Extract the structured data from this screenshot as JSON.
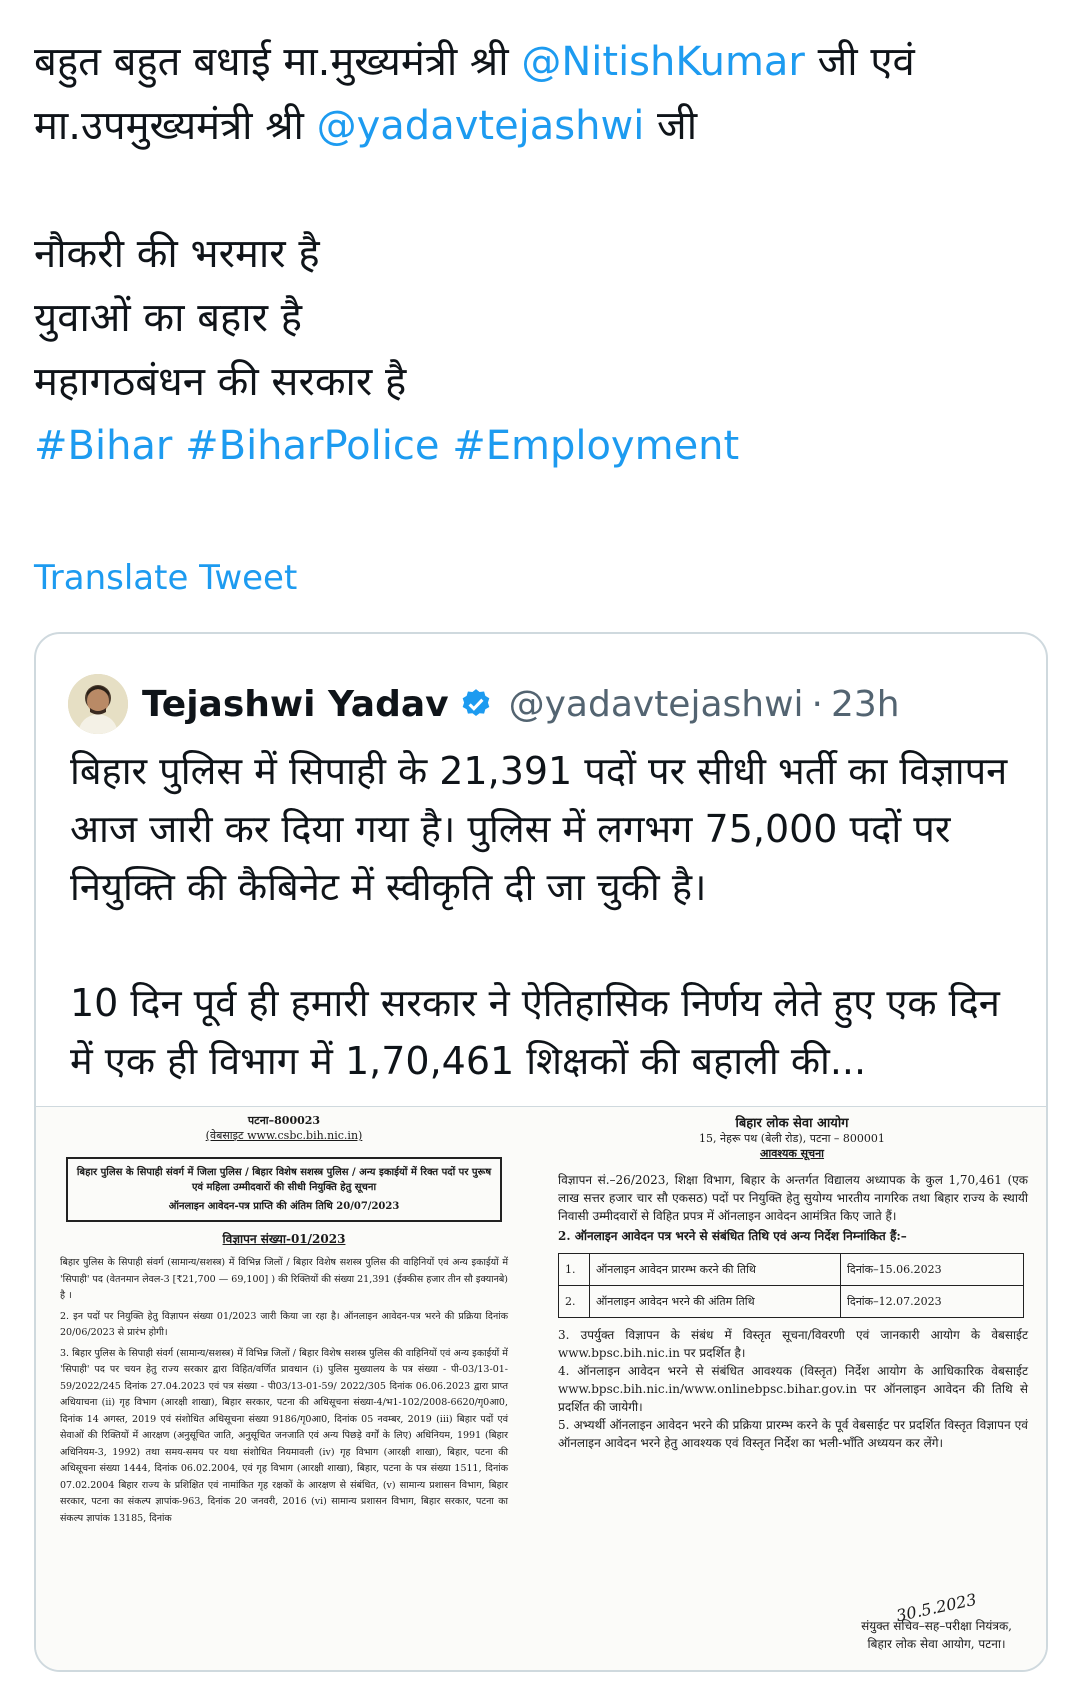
{
  "tweet": {
    "line1_text": "बहुत बहुत बधाई मा.मुख्यमंत्री श्री ",
    "line1_mention": "@NitishKumar",
    "line1_suffix": " जी एवं",
    "line2_text": "मा.उपमुख्यमंत्री श्री ",
    "line2_mention": "@yadavtejashwi",
    "line2_suffix": " जी",
    "poem": [
      "नौकरी की भरमार है",
      "युवाओं  का बहार है",
      "महागठबंधन की सरकार है"
    ],
    "hashtags": [
      "#Bihar",
      "#BiharPolice",
      "#Employment"
    ]
  },
  "translate_label": "Translate Tweet",
  "quote": {
    "author_name": "Tejashwi Yadav",
    "handle": "@yadavtejashwi",
    "separator": "·",
    "time": "23h",
    "paragraph1": "बिहार पुलिस में सिपाही के 21,391 पदों पर सीधी भर्ती का विज्ञापन आज जारी कर दिया गया है। पुलिस में लगभग 75,000 पदों पर नियुक्ति की कैबिनेट में स्वीकृति दी जा चुकी है।",
    "paragraph2": "10 दिन पूर्व ही हमारी सरकार ने ऐतिहासिक निर्णय लेते हुए एक दिन में एक ही विभाग में 1,70,461 शिक्षकों की बहाली की..."
  },
  "doc_left": {
    "header_city": "पटना–800023",
    "header_website": "(वेबसाइट  www.csbc.bih.nic.in)",
    "box_text": "बिहार पुलिस के सिपाही संवर्ग में जिला पुलिस / बिहार विशेष सशस्त्र पुलिस / अन्य इकाईयों में रिक्त पदों पर पुरूष एवं महिला उम्मीदवारों की सीधी नियुक्ति हेतु सूचना",
    "box_deadline": "ऑनलाइन आवेदन-पत्र प्राप्ति की अंतिम तिथि 20/07/2023",
    "title": "विज्ञापन संख्या-01/2023",
    "para1": "बिहार पुलिस के सिपाही संवर्ग (सामान्य/सशस्त्र) में विभिन्न जिलों / बिहार विशेष सशस्त्र पुलिस की वाहिनियों एवं अन्य इकाईयों में 'सिपाही' पद (वेतनमान लेवल-3 [₹21,700 — 69,100] ) की रिक्तियों की संख्या 21,391 (ईक्कीस हजार तीन सौ इक्यानबे) है ।",
    "para2": "2. इन पदों पर नियुक्ति हेतु विज्ञापन संख्या 01/2023 जारी किया जा रहा है। ऑनलाइन आवेदन-पत्र भरने की प्रक्रिया दिनांक 20/06/2023 से प्रारंभ होगी।",
    "para3": "3. बिहार पुलिस के सिपाही संवर्ग (सामान्य/सशस्त्र) में विभिन्न जिलों / बिहार विशेष सशस्त्र पुलिस की वाहिनियों एवं अन्य इकाईयों में 'सिपाही' पद पर चयन हेतु राज्य सरकार द्वारा विहित/वर्णित प्रावधान (i) पुलिस मुख्यालय के पत्र संख्या - पी-03/13-01-59/2022/245 दिनांक 27.04.2023 एवं पत्र संख्या - पी03/13-01-59/ 2022/305 दिनांक 06.06.2023 द्वारा प्राप्त अधियाचना (ii) गृह विभाग (आरक्षी शाखा), बिहार सरकार, पटना की अधिसूचना संख्या-4/भ1-102/2008-6620/गृ0आ0, दिनांक 14 अगस्त, 2019 एवं संशोधित अधिसूचना संख्या 9186/गृ0आ0, दिनांक 05 नवम्बर, 2019 (iii) बिहार पदों एवं सेवाओं की रिक्तियों में आरक्षण (अनुसूचित जाति, अनुसूचित जनजाति एवं अन्य पिछड़े वर्गों के लिए) अधिनियम, 1991 (बिहार अधिनियम-3, 1992) तथा समय-समय पर यथा संशोधित नियमावली (iv) गृह विभाग (आरक्षी शाखा), बिहार, पटना की अधिसूचना संख्या 1444, दिनांक 06.02.2004, एवं गृह विभाग (आरक्षी शाखा), बिहार, पटना के पत्र संख्या 1511, दिनांक 07.02.2004 बिहार राज्य के प्रशिक्षित एवं नामांकित गृह रक्षकों के आरक्षण से संबंधित, (v) सामान्य प्रशासन विभाग, बिहार सरकार, पटना का संकल्प ज्ञापांक-963, दिनांक 20 जनवरी, 2016 (vi) सामान्य प्रशासन विभाग, बिहार सरकार, पटना का संकल्प ज्ञापांक 13185, दिनांक"
  },
  "doc_right": {
    "org": "बिहार लोक सेवा आयोग",
    "address": "15, नेहरू पथ (बेली रोड), पटना – 800001",
    "notice": "आवश्यक सूचना",
    "para1": "विज्ञापन सं.–26/2023, शिक्षा विभाग, बिहार के अन्तर्गत विद्यालय अध्यापक के कुल 1,70,461 (एक लाख सत्तर हजार चार सौ एकसठ) पदों पर नियुक्ति हेतु सुयोग्य भारतीय नागरिक तथा बिहार राज्य के स्थायी निवासी उम्मीदवारों से विहित प्रपत्र में ऑनलाइन आवेदन आमंत्रित किए जाते हैं।",
    "para2": "2. ऑनलाइन आवेदन पत्र भरने से संबंधित तिथि एवं अन्य निर्देश निम्नांकित हैं:–",
    "table": [
      {
        "num": "1.",
        "label": "ऑनलाइन आवेदन प्रारम्भ करने की तिथि",
        "value": "दिनांक–15.06.2023"
      },
      {
        "num": "2.",
        "label": "ऑनलाइन आवेदन भरने की अंतिम तिथि",
        "value": "दिनांक–12.07.2023"
      }
    ],
    "para3": "3. उपर्युक्त विज्ञापन के संबंध में विस्तृत सूचना/विवरणी एवं जानकारी आयोग के वेबसाईट www.bpsc.bih.nic.in पर प्रदर्शित है।",
    "para4": "4. ऑनलाइन आवेदन भरने से संबंधित आवश्यक (विस्तृत) निर्देश आयोग के आधिकारिक वेबसाईट www.bpsc.bih.nic.in/www.onlinebpsc.bihar.gov.in पर ऑनलाइन आवेदन की तिथि से प्रदर्शित की जायेगी।",
    "para5": "5. अभ्यर्थी ऑनलाइन आवेदन भरने की प्रक्रिया प्रारम्भ करने के पूर्व वेबसाईट पर प्रदर्शित विस्तृत विज्ञापन एवं ऑनलाइन आवेदन भरने हेतु आवश्यक एवं विस्तृत निर्देश का भली-भाँति अध्ययन कर लेंगे।",
    "signature_date": "30.5.2023",
    "signatory": "संयुक्त सचिव–सह–परीक्षा नियंत्रक,",
    "signatory_org": "बिहार लोक सेवा आयोग, पटना।"
  },
  "colors": {
    "link": "#1d9bf0",
    "secondary_text": "#536471",
    "border": "#cfd9de",
    "verified_badge": "#1d9bf0"
  },
  "icons": {
    "verified": "verified-badge-icon",
    "avatar": "avatar"
  }
}
